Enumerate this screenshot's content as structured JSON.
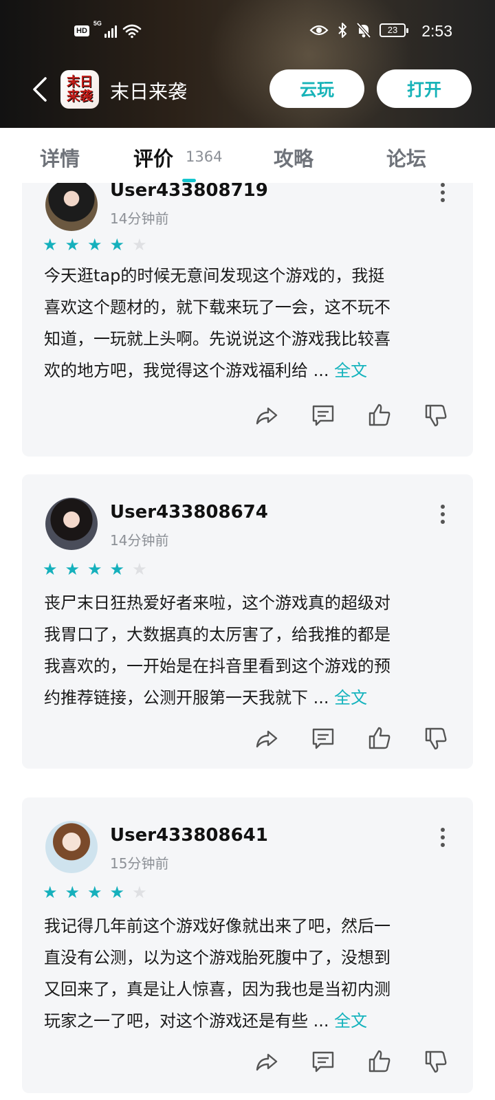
{
  "status_bar": {
    "hd": "HD",
    "net": "5G",
    "battery": "23",
    "time": "2:53"
  },
  "app": {
    "title": "末日来袭",
    "logo_line1": "末日",
    "logo_line2": "来袭",
    "cloud_play": "云玩",
    "open": "打开"
  },
  "tabs": {
    "details": "详情",
    "reviews": "评价",
    "reviews_count": "1364",
    "guides": "攻略",
    "forum": "论坛"
  },
  "reviews": [
    {
      "username": "User433808719",
      "time": "14分钟前",
      "rating": 4,
      "text_lines": [
        "今天逛tap的时候无意间发现这个游戏的，我挺",
        "喜欢这个题材的，就下载来玩了一会，这不玩不",
        "知道，一玩就上头啊。先说说这个游戏我比较喜",
        "欢的地方吧，我觉得这个游戏福利给 ... "
      ],
      "more": "全文"
    },
    {
      "username": "User433808674",
      "time": "14分钟前",
      "rating": 4,
      "text_lines": [
        "丧尸末日狂热爱好者来啦，这个游戏真的超级对",
        "我胃口了，大数据真的太厉害了，给我推的都是",
        "我喜欢的，一开始是在抖音里看到这个游戏的预",
        "约推荐链接，公测开服第一天我就下 ... "
      ],
      "more": "全文"
    },
    {
      "username": "User433808641",
      "time": "15分钟前",
      "rating": 4,
      "text_lines": [
        "我记得几年前这个游戏好像就出来了吧，然后一",
        "直没有公测，以为这个游戏胎死腹中了，没想到",
        "又回来了，真是让人惊喜，因为我也是当初内测",
        "玩家之一了吧，对这个游戏还是有些 ... "
      ],
      "more": "全文"
    }
  ],
  "colors": {
    "accent": "#15b0bc",
    "card_bg": "#f5f6f8",
    "star_off": "#dfe0e3"
  }
}
